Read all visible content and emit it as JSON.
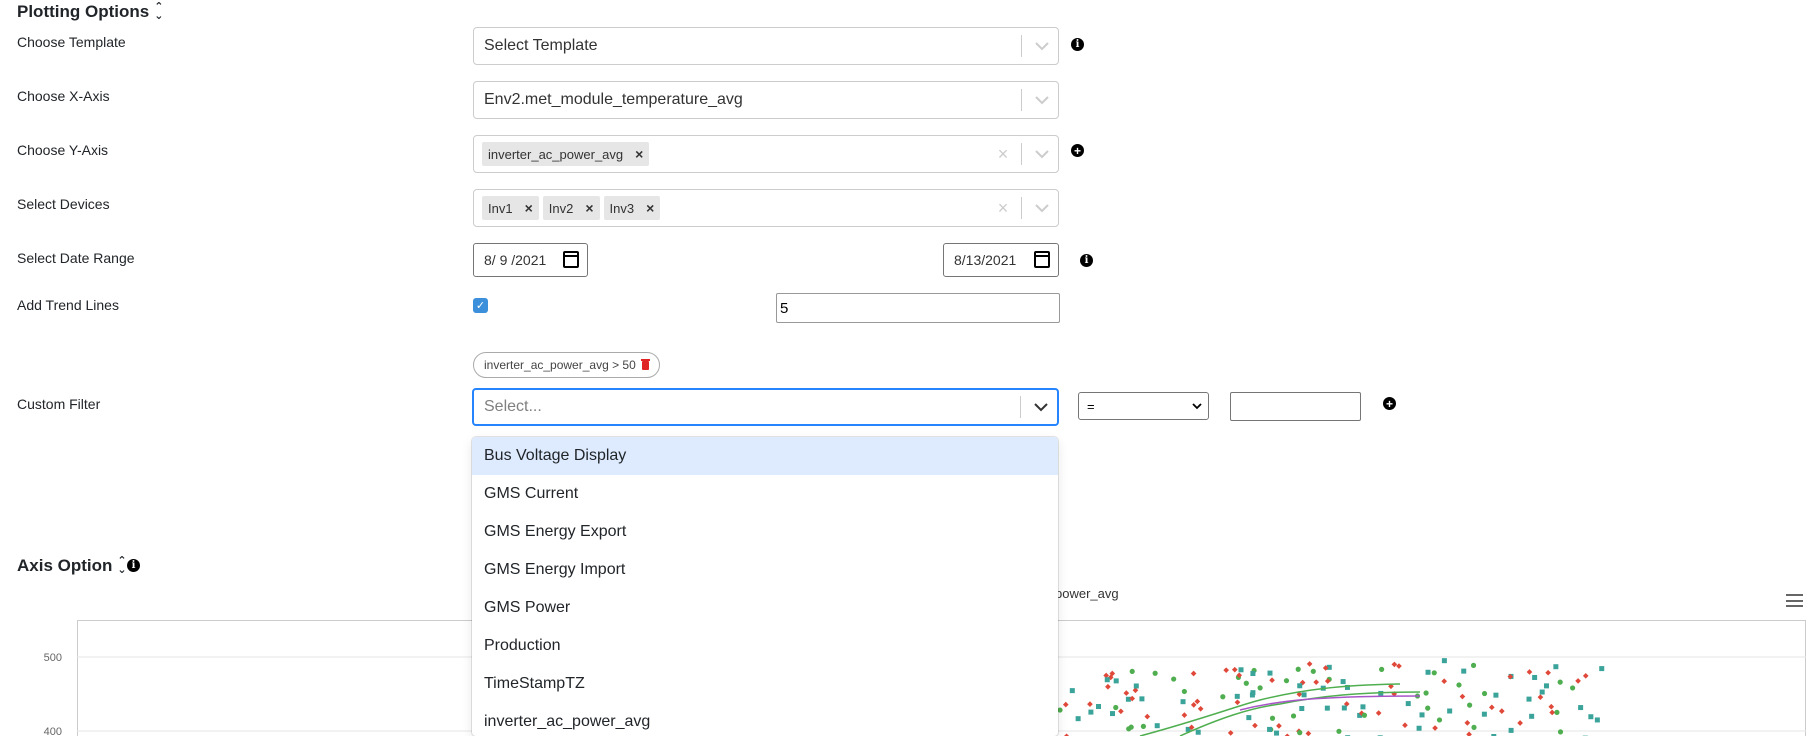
{
  "plotting_options": {
    "title": "Plotting Options"
  },
  "rows": {
    "template": {
      "label": "Choose Template",
      "value": "Select Template"
    },
    "x_axis": {
      "label": "Choose X-Axis",
      "value": "Env2.met_module_temperature_avg"
    },
    "y_axis": {
      "label": "Choose Y-Axis",
      "chips": [
        "inverter_ac_power_avg"
      ]
    },
    "devices": {
      "label": "Select Devices",
      "chips": [
        "Inv1",
        "Inv2",
        "Inv3"
      ]
    },
    "date_range": {
      "label": "Select Date Range",
      "start": "8/ 9 /2021",
      "end": "8/13/2021"
    },
    "trend": {
      "label": "Add Trend Lines",
      "checked": true,
      "value": "5"
    },
    "custom_filter": {
      "label": "Custom Filter",
      "active_filter": "inverter_ac_power_avg > 50",
      "placeholder": "Select...",
      "operator": "=",
      "value": ""
    }
  },
  "dropdown_options": [
    "Bus Voltage Display",
    "GMS Current",
    "GMS Energy Export",
    "GMS Energy Import",
    "GMS Power",
    "Production",
    "TimeStampTZ",
    "inverter_ac_power_avg"
  ],
  "axis_option": {
    "title": "Axis Option"
  },
  "chart": {
    "title_fragment": "power_avg",
    "y_ticks": [
      "500",
      "400"
    ]
  },
  "colors": {
    "accent": "#2684ff",
    "highlight": "#deebff",
    "series_teal": "#3aa39a",
    "series_red": "#e0483a",
    "series_green": "#4fae4f",
    "series_purple": "#a855c8"
  }
}
